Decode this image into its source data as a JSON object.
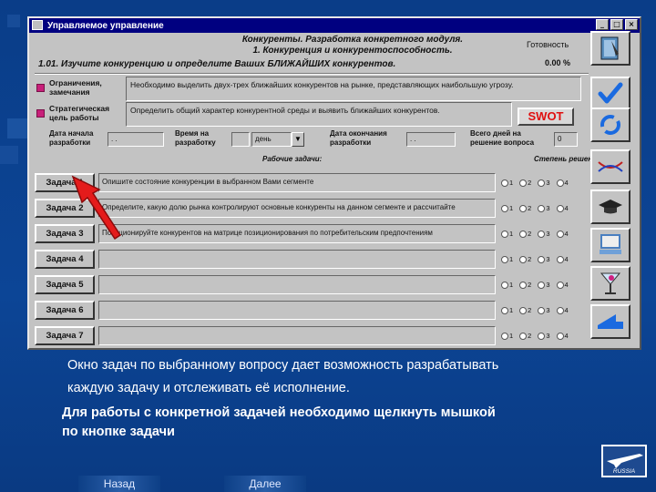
{
  "window": {
    "title": "Управляемое управление",
    "controls": [
      "_",
      "□",
      "×"
    ]
  },
  "header": {
    "line1": "Конкуренты. Разработка конкретного модуля.",
    "line2": "1. Конкуренция и конкурентоспособность.",
    "line3": "1.01. Изучите конкуренцию и определите Ваших БЛИЖАЙШИХ конкурентов.",
    "ready_label": "Готовность",
    "ready_value": "0.00 %"
  },
  "constraints": {
    "label": "Ограничения, замечания",
    "text": "Необходимо выделить двух-трех ближайших конкурентов на рынке, представляющих наибольшую угрозу."
  },
  "goal": {
    "label": "Стратегическая цель работы",
    "text": "Определить общий характер конкурентной среды и выявить ближайших конкурентов."
  },
  "swot_label": "SWOT",
  "dates": {
    "start_label": "Дата начала разработки",
    "start_value": ". .",
    "time_label": "Время на разработку",
    "time_unit": "день",
    "end_label": "Дата окончания разработки",
    "end_value": ". .",
    "days_label": "Всего дней на решение вопроса",
    "days_value": "0"
  },
  "sections": {
    "tasks_header": "Рабочие задачи:",
    "status_header": "Степень решения:"
  },
  "tasks": [
    {
      "label": "Задача 1",
      "text": "Опишите состояние конкуренции в выбранном Вами сегменте"
    },
    {
      "label": "Задача 2",
      "text": "Определите, какую долю рынка контролируют основные конкуренты на данном сегменте и рассчитайте"
    },
    {
      "label": "Задача 3",
      "text": "Позиционируйте конкурентов на матрице позиционирования по потребительским предпочтениям"
    },
    {
      "label": "Задача 4",
      "text": ""
    },
    {
      "label": "Задача 5",
      "text": ""
    },
    {
      "label": "Задача 6",
      "text": ""
    },
    {
      "label": "Задача 7",
      "text": ""
    }
  ],
  "radio_options": [
    "1",
    "2",
    "3",
    "4"
  ],
  "right_panel_icons": [
    "notebook-icon",
    "checkmark-icon",
    "refresh-arrows-icon",
    "dna-icon",
    "graduation-cap-icon",
    "computer-icon",
    "martini-glass-icon",
    "back-arrow-icon"
  ],
  "caption": {
    "line1": "Окно задач по выбранному вопросу дает возможность разрабатывать",
    "line2": "каждую задачу и отслеживать её исполнение.",
    "bold1": "Для работы с конкретной задачей необходимо щелкнуть мышкой",
    "bold2": "по кнопке задачи"
  },
  "nav": {
    "back": "Назад",
    "next": "Далее"
  },
  "logo_text": "RUSSIA",
  "colors": {
    "background": "#0b3f8c",
    "titlebar": "#000080",
    "window": "#c3c3c3",
    "accent_pink": "#c8207a",
    "swot_red": "#e01010",
    "pointer_arrow": "#e41b1b"
  }
}
